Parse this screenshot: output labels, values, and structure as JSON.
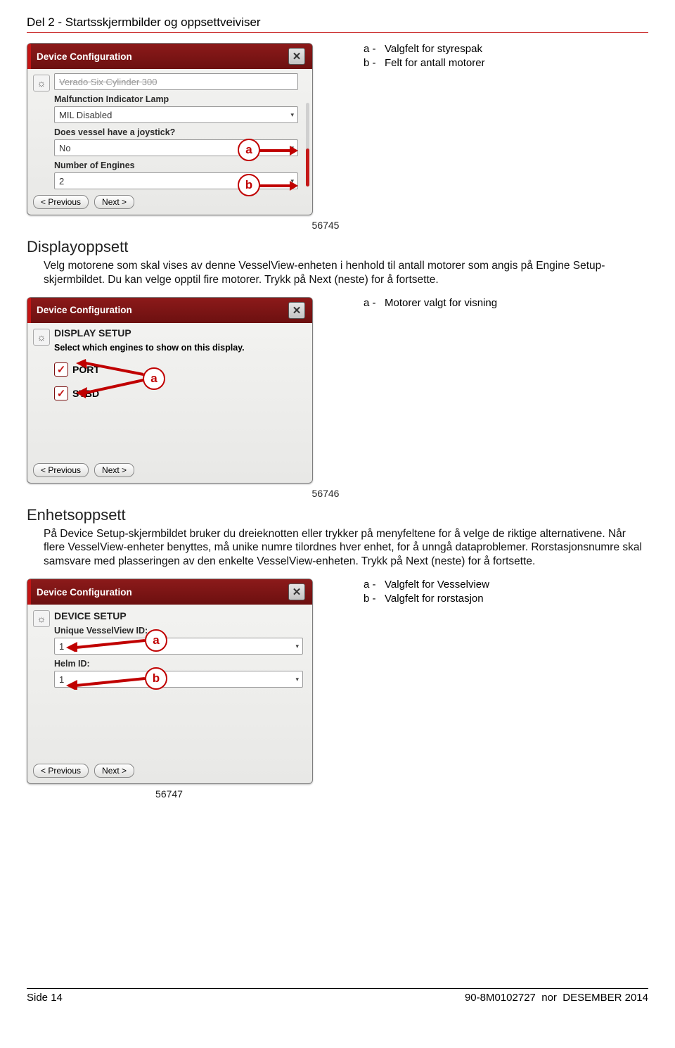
{
  "header": {
    "title": "Del 2 - Startsskjermbilder og oppsettveiviser"
  },
  "panel1": {
    "title": "Device Configuration",
    "field_cut": "Verado Six Cylinder 300",
    "label_mil": "Malfunction Indicator Lamp",
    "value_mil": "MIL Disabled",
    "label_joystick": "Does vessel have a joystick?",
    "value_joystick": "No",
    "label_engines": "Number of Engines",
    "value_engines": "2",
    "prev": "< Previous",
    "next": "Next >",
    "fig": "56745",
    "bubble_a": "a",
    "bubble_b": "b"
  },
  "legend1": {
    "a_key": "a -",
    "a_text": "Valgfelt for styrespak",
    "b_key": "b -",
    "b_text": "Felt for antall motorer"
  },
  "sec1": {
    "heading": "Displayoppsett",
    "para": "Velg motorene som skal vises av denne VesselView-enheten i henhold til antall motorer som angis på Engine Setup-skjermbildet. Du kan velge opptil fire motorer. Trykk på Next (neste) for å fortsette."
  },
  "panel2": {
    "title": "Device Configuration",
    "subheading": "DISPLAY SETUP",
    "instr": "Select which engines to show on this display.",
    "port": "PORT",
    "stbd": "STBD",
    "prev": "< Previous",
    "next": "Next >",
    "fig": "56746",
    "bubble_a": "a"
  },
  "legend2": {
    "a_key": "a -",
    "a_text": "Motorer valgt for visning"
  },
  "sec2": {
    "heading": "Enhetsoppsett",
    "para": "På Device Setup-skjermbildet bruker du dreieknotten eller trykker på menyfeltene for å velge de riktige alternativene. Når flere VesselView-enheter benyttes, må unike numre tilordnes hver enhet, for å unngå dataproblemer. Rorstasjonsnumre skal samsvare med plasseringen av den enkelte VesselView-enheten. Trykk på Next (neste) for å fortsette."
  },
  "panel3": {
    "title": "Device Configuration",
    "subheading": "DEVICE SETUP",
    "label_id": "Unique VesselView ID:",
    "value_id": "1",
    "label_helm": "Helm ID:",
    "value_helm": "1",
    "prev": "< Previous",
    "next": "Next >",
    "fig": "56747",
    "bubble_a": "a",
    "bubble_b": "b"
  },
  "legend3": {
    "a_key": "a -",
    "a_text": "Valgfelt for Vesselview",
    "b_key": "b -",
    "b_text": "Valgfelt for rorstasjon"
  },
  "footer": {
    "left": "Side  14",
    "right_code": "90-8M0102727",
    "right_nor": "nor",
    "right_date": "DESEMBER  2014"
  }
}
